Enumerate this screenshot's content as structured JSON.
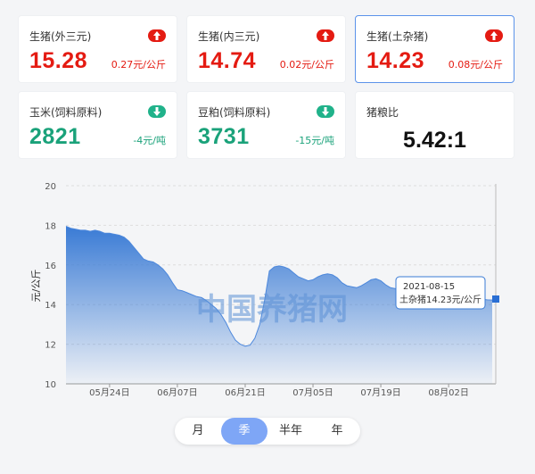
{
  "cards": [
    {
      "name": "生猪(外三元)",
      "price": "15.28",
      "change": "0.27元/公斤",
      "dir": "up"
    },
    {
      "name": "生猪(内三元)",
      "price": "14.74",
      "change": "0.02元/公斤",
      "dir": "up"
    },
    {
      "name": "生猪(土杂猪)",
      "price": "14.23",
      "change": "0.08元/公斤",
      "dir": "up"
    },
    {
      "name": "玉米(饲料原料)",
      "price": "2821",
      "change": "-4元/吨",
      "dir": "down"
    },
    {
      "name": "豆粕(饲料原料)",
      "price": "3731",
      "change": "-15元/吨",
      "dir": "down"
    },
    {
      "name": "猪粮比",
      "price": "5.42:1"
    }
  ],
  "chart_data": {
    "type": "area",
    "ylabel": "元/公斤",
    "ylim": [
      10,
      20
    ],
    "yticks": [
      "10",
      "12",
      "14",
      "16",
      "18",
      "20"
    ],
    "xticks": [
      {
        "label": "05月24日",
        "day": 9
      },
      {
        "label": "06月07日",
        "day": 23
      },
      {
        "label": "06月21日",
        "day": 37
      },
      {
        "label": "07月05日",
        "day": 51
      },
      {
        "label": "07月19日",
        "day": 65
      },
      {
        "label": "08月02日",
        "day": 79
      }
    ],
    "x_start_date": "2021-05-15",
    "series": [
      {
        "values": [
          17.95,
          17.85,
          17.8,
          17.75,
          17.75,
          17.7,
          17.75,
          17.7,
          17.6,
          17.6,
          17.55,
          17.5,
          17.4,
          17.2,
          16.9,
          16.6,
          16.3,
          16.2,
          16.15,
          16.0,
          15.8,
          15.5,
          15.1,
          14.75,
          14.7,
          14.6,
          14.5,
          14.4,
          14.35,
          14.2,
          14.0,
          13.8,
          13.5,
          13.1,
          12.6,
          12.2,
          12.0,
          11.9,
          11.95,
          12.3,
          13.0,
          14.2,
          15.7,
          15.9,
          15.95,
          15.9,
          15.8,
          15.6,
          15.4,
          15.3,
          15.2,
          15.25,
          15.4,
          15.5,
          15.55,
          15.5,
          15.35,
          15.1,
          14.95,
          14.9,
          14.85,
          14.95,
          15.1,
          15.25,
          15.3,
          15.2,
          15.0,
          14.85,
          14.8,
          14.9,
          15.0,
          14.95,
          14.9,
          14.7,
          14.5,
          14.45,
          14.5,
          14.6,
          14.65,
          14.5,
          14.4,
          14.35,
          14.3,
          14.25,
          14.3,
          14.28,
          14.26,
          14.24,
          14.23
        ]
      }
    ],
    "tooltip": {
      "date": "2021-08-15",
      "text": "土杂猪14.23元/公斤"
    },
    "watermark": "中国养猪网",
    "grid": true
  },
  "periods": [
    "月",
    "季",
    "半年",
    "年"
  ],
  "active_period": "季"
}
